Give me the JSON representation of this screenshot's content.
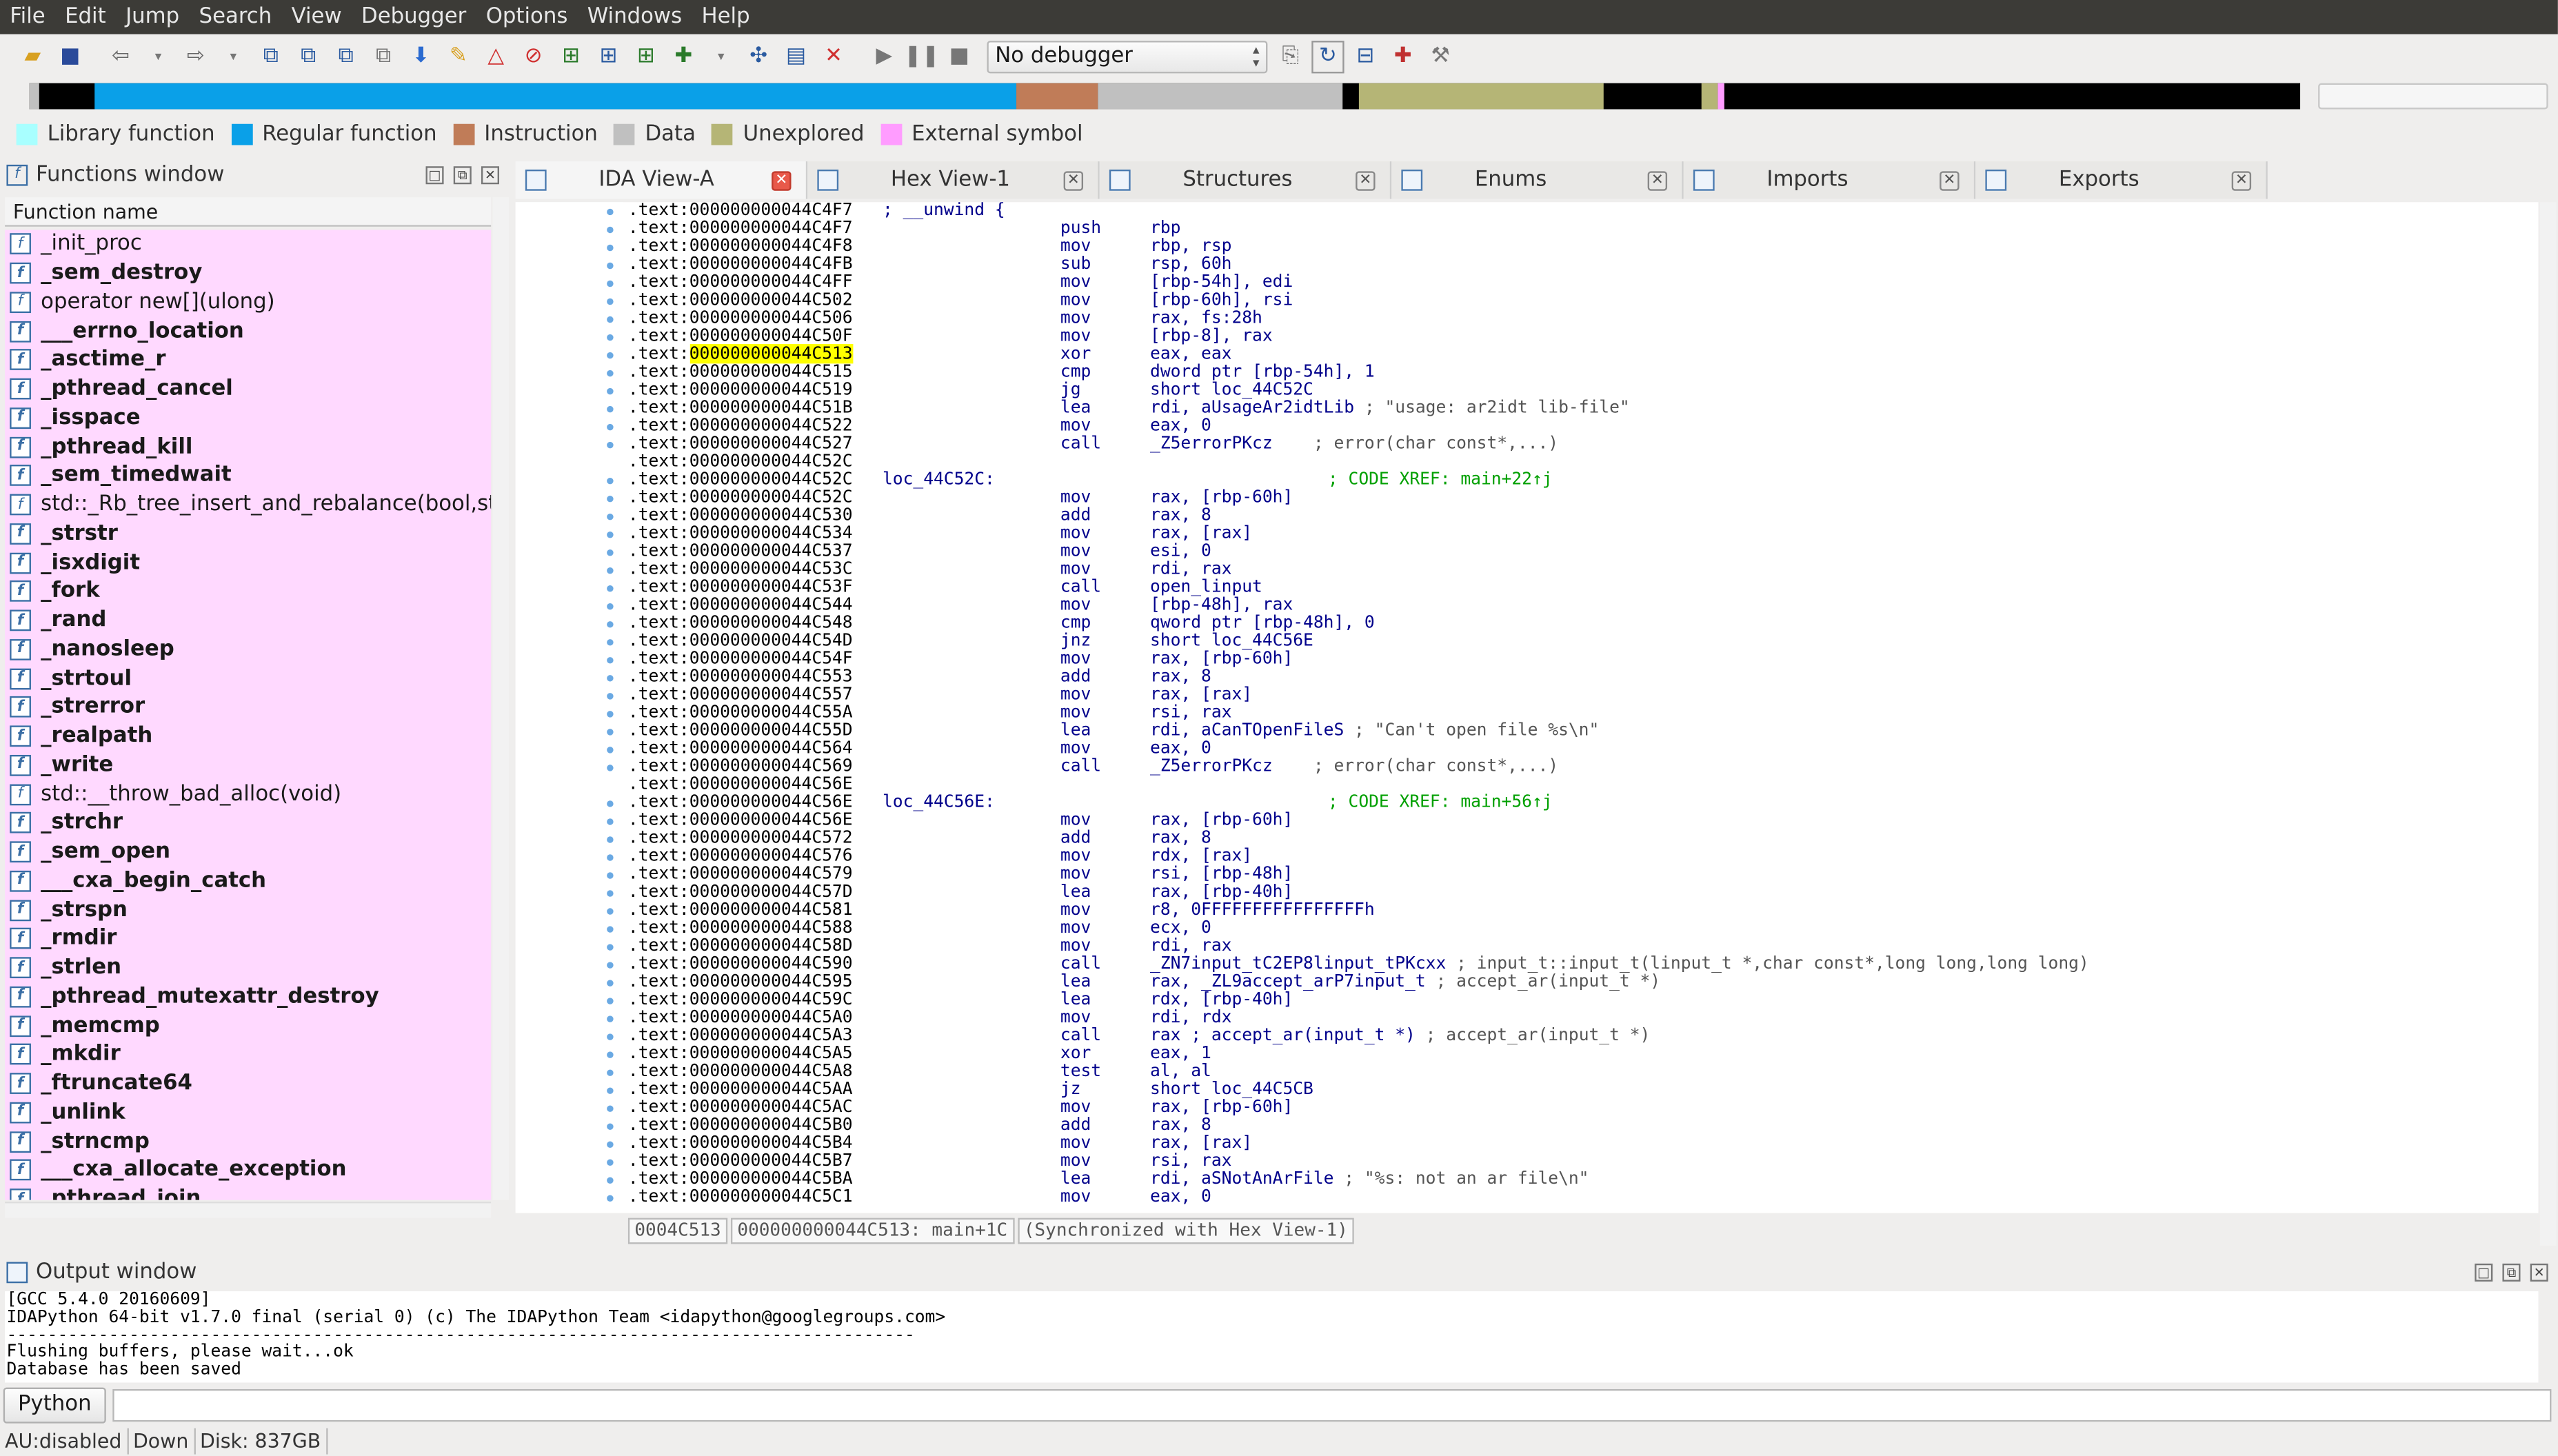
{
  "menu": [
    "File",
    "Edit",
    "Jump",
    "Search",
    "View",
    "Debugger",
    "Options",
    "Windows",
    "Help"
  ],
  "toolbar": {
    "debugger_select": "No debugger"
  },
  "legend": [
    {
      "label": "Library function",
      "color": "#a8ffff"
    },
    {
      "label": "Regular function",
      "color": "#0aa0e8"
    },
    {
      "label": "Instruction",
      "color": "#c07c58"
    },
    {
      "label": "Data",
      "color": "#c0c0c0"
    },
    {
      "label": "Unexplored",
      "color": "#b5b576"
    },
    {
      "label": "External symbol",
      "color": "#ff9cff"
    }
  ],
  "functions_window": {
    "title": "Functions window",
    "column": "Function name",
    "items": [
      {
        "name": "_init_proc",
        "bold": false
      },
      {
        "name": "_sem_destroy",
        "bold": true
      },
      {
        "name": "operator new[](ulong)",
        "bold": false
      },
      {
        "name": "___errno_location",
        "bold": true
      },
      {
        "name": "_asctime_r",
        "bold": true
      },
      {
        "name": "_pthread_cancel",
        "bold": true
      },
      {
        "name": "_isspace",
        "bold": true
      },
      {
        "name": "_pthread_kill",
        "bold": true
      },
      {
        "name": "_sem_timedwait",
        "bold": true
      },
      {
        "name": "std::_Rb_tree_insert_and_rebalance(bool,std::_R",
        "bold": false
      },
      {
        "name": "_strstr",
        "bold": true
      },
      {
        "name": "_isxdigit",
        "bold": true
      },
      {
        "name": "_fork",
        "bold": true
      },
      {
        "name": "_rand",
        "bold": true
      },
      {
        "name": "_nanosleep",
        "bold": true
      },
      {
        "name": "_strtoul",
        "bold": true
      },
      {
        "name": "_strerror",
        "bold": true
      },
      {
        "name": "_realpath",
        "bold": true
      },
      {
        "name": "_write",
        "bold": true
      },
      {
        "name": "std::__throw_bad_alloc(void)",
        "bold": false
      },
      {
        "name": "_strchr",
        "bold": true
      },
      {
        "name": "_sem_open",
        "bold": true
      },
      {
        "name": "___cxa_begin_catch",
        "bold": true
      },
      {
        "name": "_strspn",
        "bold": true
      },
      {
        "name": "_rmdir",
        "bold": true
      },
      {
        "name": "_strlen",
        "bold": true
      },
      {
        "name": "_pthread_mutexattr_destroy",
        "bold": true
      },
      {
        "name": "_memcmp",
        "bold": true
      },
      {
        "name": "_mkdir",
        "bold": true
      },
      {
        "name": "_ftruncate64",
        "bold": true
      },
      {
        "name": "_unlink",
        "bold": true
      },
      {
        "name": "_strncmp",
        "bold": true
      },
      {
        "name": "___cxa_allocate_exception",
        "bold": true
      },
      {
        "name": "_pthread_join",
        "bold": true
      }
    ]
  },
  "tabs": [
    {
      "label": "IDA View-A",
      "active": true
    },
    {
      "label": "Hex View-1",
      "active": false
    },
    {
      "label": "Structures",
      "active": false
    },
    {
      "label": "Enums",
      "active": false
    },
    {
      "label": "Imports",
      "active": false
    },
    {
      "label": "Exports",
      "active": false
    }
  ],
  "disasm": [
    {
      "a": ".text:000000000044C4F7",
      "l": "; __unwind {",
      "m": "",
      "o": "",
      "c": ""
    },
    {
      "a": ".text:000000000044C4F7",
      "l": "",
      "m": "push",
      "o": "rbp",
      "c": ""
    },
    {
      "a": ".text:000000000044C4F8",
      "l": "",
      "m": "mov",
      "o": "rbp, rsp",
      "c": ""
    },
    {
      "a": ".text:000000000044C4FB",
      "l": "",
      "m": "sub",
      "o": "rsp, 60h",
      "c": ""
    },
    {
      "a": ".text:000000000044C4FF",
      "l": "",
      "m": "mov",
      "o": "[rbp-54h], edi",
      "c": ""
    },
    {
      "a": ".text:000000000044C502",
      "l": "",
      "m": "mov",
      "o": "[rbp-60h], rsi",
      "c": ""
    },
    {
      "a": ".text:000000000044C506",
      "l": "",
      "m": "mov",
      "o": "rax, fs:28h",
      "c": ""
    },
    {
      "a": ".text:000000000044C50F",
      "l": "",
      "m": "mov",
      "o": "[rbp-8], rax",
      "c": ""
    },
    {
      "a": ".text:000000000044C513",
      "l": "",
      "m": "xor",
      "o": "eax, eax",
      "c": "",
      "hl": true
    },
    {
      "a": ".text:000000000044C515",
      "l": "",
      "m": "cmp",
      "o": "dword ptr [rbp-54h], 1",
      "c": ""
    },
    {
      "a": ".text:000000000044C519",
      "l": "",
      "m": "jg",
      "o": "short loc_44C52C",
      "c": ""
    },
    {
      "a": ".text:000000000044C51B",
      "l": "",
      "m": "lea",
      "o": "rdi, aUsageAr2idtLib",
      "c": " ; \"usage: ar2idt lib-file\""
    },
    {
      "a": ".text:000000000044C522",
      "l": "",
      "m": "mov",
      "o": "eax, 0",
      "c": ""
    },
    {
      "a": ".text:000000000044C527",
      "l": "",
      "m": "call",
      "o": "_Z5errorPKcz",
      "c": "    ; error(char const*,...)"
    },
    {
      "a": ".text:000000000044C52C",
      "l": "",
      "m": "",
      "o": "",
      "c": ""
    },
    {
      "a": ".text:000000000044C52C",
      "l": "loc_44C52C:",
      "m": "",
      "o": "",
      "x": "; CODE XREF: main+22↑j"
    },
    {
      "a": ".text:000000000044C52C",
      "l": "",
      "m": "mov",
      "o": "rax, [rbp-60h]",
      "c": ""
    },
    {
      "a": ".text:000000000044C530",
      "l": "",
      "m": "add",
      "o": "rax, 8",
      "c": ""
    },
    {
      "a": ".text:000000000044C534",
      "l": "",
      "m": "mov",
      "o": "rax, [rax]",
      "c": ""
    },
    {
      "a": ".text:000000000044C537",
      "l": "",
      "m": "mov",
      "o": "esi, 0",
      "c": ""
    },
    {
      "a": ".text:000000000044C53C",
      "l": "",
      "m": "mov",
      "o": "rdi, rax",
      "c": ""
    },
    {
      "a": ".text:000000000044C53F",
      "l": "",
      "m": "call",
      "o": "open_linput",
      "c": ""
    },
    {
      "a": ".text:000000000044C544",
      "l": "",
      "m": "mov",
      "o": "[rbp-48h], rax",
      "c": ""
    },
    {
      "a": ".text:000000000044C548",
      "l": "",
      "m": "cmp",
      "o": "qword ptr [rbp-48h], 0",
      "c": ""
    },
    {
      "a": ".text:000000000044C54D",
      "l": "",
      "m": "jnz",
      "o": "short loc_44C56E",
      "c": ""
    },
    {
      "a": ".text:000000000044C54F",
      "l": "",
      "m": "mov",
      "o": "rax, [rbp-60h]",
      "c": ""
    },
    {
      "a": ".text:000000000044C553",
      "l": "",
      "m": "add",
      "o": "rax, 8",
      "c": ""
    },
    {
      "a": ".text:000000000044C557",
      "l": "",
      "m": "mov",
      "o": "rax, [rax]",
      "c": ""
    },
    {
      "a": ".text:000000000044C55A",
      "l": "",
      "m": "mov",
      "o": "rsi, rax",
      "c": ""
    },
    {
      "a": ".text:000000000044C55D",
      "l": "",
      "m": "lea",
      "o": "rdi, aCanTOpenFileS",
      "c": " ; \"Can't open file %s\\n\""
    },
    {
      "a": ".text:000000000044C564",
      "l": "",
      "m": "mov",
      "o": "eax, 0",
      "c": ""
    },
    {
      "a": ".text:000000000044C569",
      "l": "",
      "m": "call",
      "o": "_Z5errorPKcz",
      "c": "    ; error(char const*,...)"
    },
    {
      "a": ".text:000000000044C56E",
      "l": "",
      "m": "",
      "o": "",
      "c": ""
    },
    {
      "a": ".text:000000000044C56E",
      "l": "loc_44C56E:",
      "m": "",
      "o": "",
      "x": "; CODE XREF: main+56↑j"
    },
    {
      "a": ".text:000000000044C56E",
      "l": "",
      "m": "mov",
      "o": "rax, [rbp-60h]",
      "c": ""
    },
    {
      "a": ".text:000000000044C572",
      "l": "",
      "m": "add",
      "o": "rax, 8",
      "c": ""
    },
    {
      "a": ".text:000000000044C576",
      "l": "",
      "m": "mov",
      "o": "rdx, [rax]",
      "c": ""
    },
    {
      "a": ".text:000000000044C579",
      "l": "",
      "m": "mov",
      "o": "rsi, [rbp-48h]",
      "c": ""
    },
    {
      "a": ".text:000000000044C57D",
      "l": "",
      "m": "lea",
      "o": "rax, [rbp-40h]",
      "c": ""
    },
    {
      "a": ".text:000000000044C581",
      "l": "",
      "m": "mov",
      "o": "r8, 0FFFFFFFFFFFFFFFFh",
      "c": ""
    },
    {
      "a": ".text:000000000044C588",
      "l": "",
      "m": "mov",
      "o": "ecx, 0",
      "c": ""
    },
    {
      "a": ".text:000000000044C58D",
      "l": "",
      "m": "mov",
      "o": "rdi, rax",
      "c": ""
    },
    {
      "a": ".text:000000000044C590",
      "l": "",
      "m": "call",
      "o": "_ZN7input_tC2EP8linput_tPKcxx",
      "c": " ; input_t::input_t(linput_t *,char const*,long long,long long)"
    },
    {
      "a": ".text:000000000044C595",
      "l": "",
      "m": "lea",
      "o": "rax, _ZL9accept_arP7input_t",
      "c": " ; accept_ar(input_t *)"
    },
    {
      "a": ".text:000000000044C59C",
      "l": "",
      "m": "lea",
      "o": "rdx, [rbp-40h]",
      "c": ""
    },
    {
      "a": ".text:000000000044C5A0",
      "l": "",
      "m": "mov",
      "o": "rdi, rdx",
      "c": ""
    },
    {
      "a": ".text:000000000044C5A3",
      "l": "",
      "m": "call",
      "o": "rax ; accept_ar(input_t *)",
      "c": " ; accept_ar(input_t *)"
    },
    {
      "a": ".text:000000000044C5A5",
      "l": "",
      "m": "xor",
      "o": "eax, 1",
      "c": ""
    },
    {
      "a": ".text:000000000044C5A8",
      "l": "",
      "m": "test",
      "o": "al, al",
      "c": ""
    },
    {
      "a": ".text:000000000044C5AA",
      "l": "",
      "m": "jz",
      "o": "short loc_44C5CB",
      "c": ""
    },
    {
      "a": ".text:000000000044C5AC",
      "l": "",
      "m": "mov",
      "o": "rax, [rbp-60h]",
      "c": ""
    },
    {
      "a": ".text:000000000044C5B0",
      "l": "",
      "m": "add",
      "o": "rax, 8",
      "c": ""
    },
    {
      "a": ".text:000000000044C5B4",
      "l": "",
      "m": "mov",
      "o": "rax, [rax]",
      "c": ""
    },
    {
      "a": ".text:000000000044C5B7",
      "l": "",
      "m": "mov",
      "o": "rsi, rax",
      "c": ""
    },
    {
      "a": ".text:000000000044C5BA",
      "l": "",
      "m": "lea",
      "o": "rdi, aSNotAnArFile",
      "c": " ; \"%s: not an ar file\\n\""
    },
    {
      "a": ".text:000000000044C5C1",
      "l": "",
      "m": "mov",
      "o": "eax, 0",
      "c": ""
    }
  ],
  "disasm_status": [
    "0004C513",
    "000000000044C513: main+1C",
    "(Synchronized with Hex View-1)"
  ],
  "output_window": {
    "title": "Output window",
    "lines": [
      "[GCC 5.4.0 20160609]",
      "IDAPython 64-bit v1.7.0 final (serial 0) (c) The IDAPython Team <idapython@googlegroups.com>",
      "-----------------------------------------------------------------------------------------",
      "Flushing buffers, please wait...ok",
      "Database has been saved"
    ]
  },
  "python_button": "Python",
  "statusbar": [
    "AU:disabled",
    "Down",
    "Disk: 837GB"
  ]
}
